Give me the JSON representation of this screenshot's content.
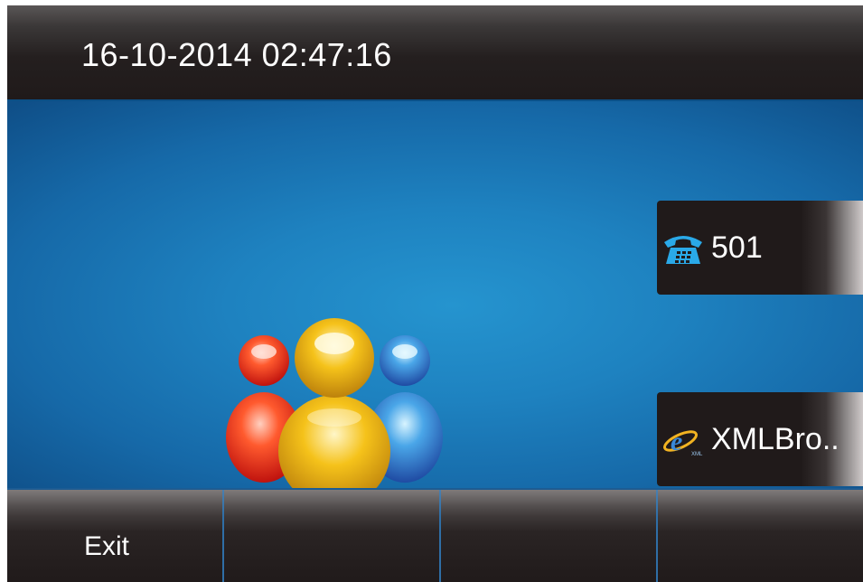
{
  "status_bar": {
    "datetime": "16-10-2014 02:47:16"
  },
  "desktop": {
    "icon": "group-contacts-icon"
  },
  "line_keys": [
    {
      "icon": "phone-icon",
      "label": "501"
    },
    {
      "icon": "xml-browser-icon",
      "label": "XMLBro.."
    }
  ],
  "softkeys": [
    {
      "label": "Exit"
    },
    {
      "label": ""
    },
    {
      "label": ""
    },
    {
      "label": ""
    }
  ],
  "colors": {
    "bar": "#201a1a",
    "desktop_blue": "#1e82c0",
    "separator": "#2f6ea6",
    "text": "#ffffff"
  }
}
